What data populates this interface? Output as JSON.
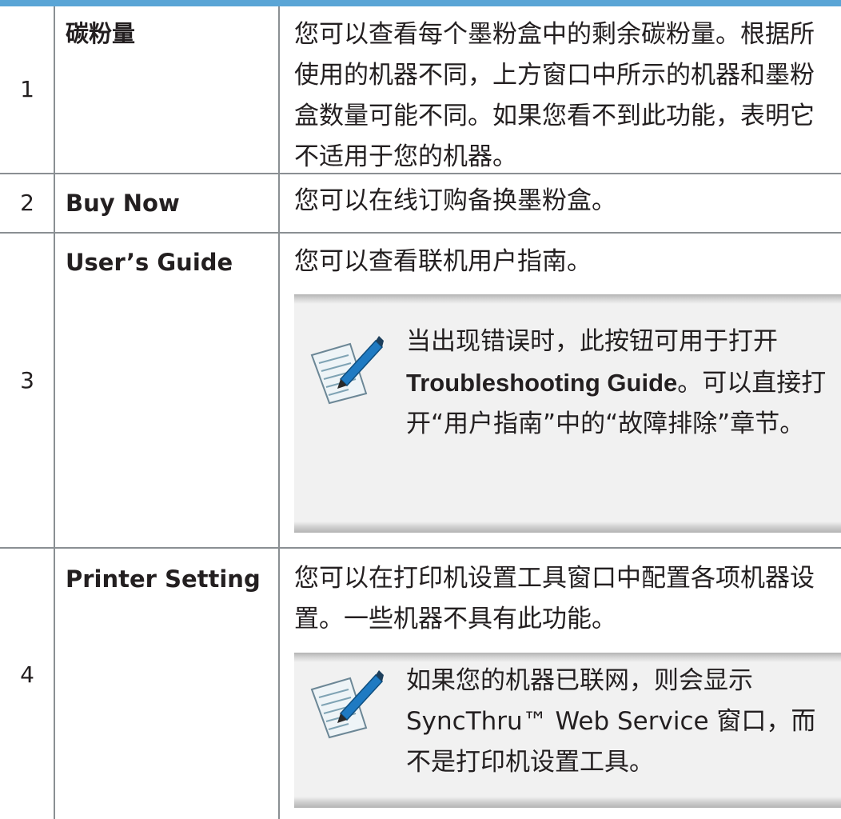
{
  "rows": [
    {
      "num": "1",
      "name": "碳粉量",
      "desc": "您可以查看每个墨粉盒中的剩余碳粉量。根据所使用的机器不同，上方窗口中所示的机器和墨粉盒数量可能不同。如果您看不到此功能，表明它不适用于您的机器。"
    },
    {
      "num": "2",
      "name": "Buy Now",
      "desc": "您可以在线订购备换墨粉盒。"
    },
    {
      "num": "3",
      "name": "User’s Guide",
      "desc": "您可以查看联机用户指南。",
      "note": {
        "before": "当出现错误时，此按钮可用于打开",
        "bold": "Troubleshooting Guide",
        "after": "。可以直接打开“用户指南”中的“故障排除”章节。"
      }
    },
    {
      "num": "4",
      "name": "Printer Setting",
      "desc": "您可以在打印机设置工具窗口中配置各项机器设置。一些机器不具有此功能。",
      "note": {
        "text": "如果您的机器已联网，则会显示 SyncThru™ Web Service 窗口，而不是打印机设置工具。"
      }
    }
  ],
  "icons": {
    "note": "note-pencil-icon"
  },
  "colors": {
    "top_rule": "#5aa5d6",
    "grid": "#8a8f93",
    "note_bg": "#f1f1f1"
  }
}
